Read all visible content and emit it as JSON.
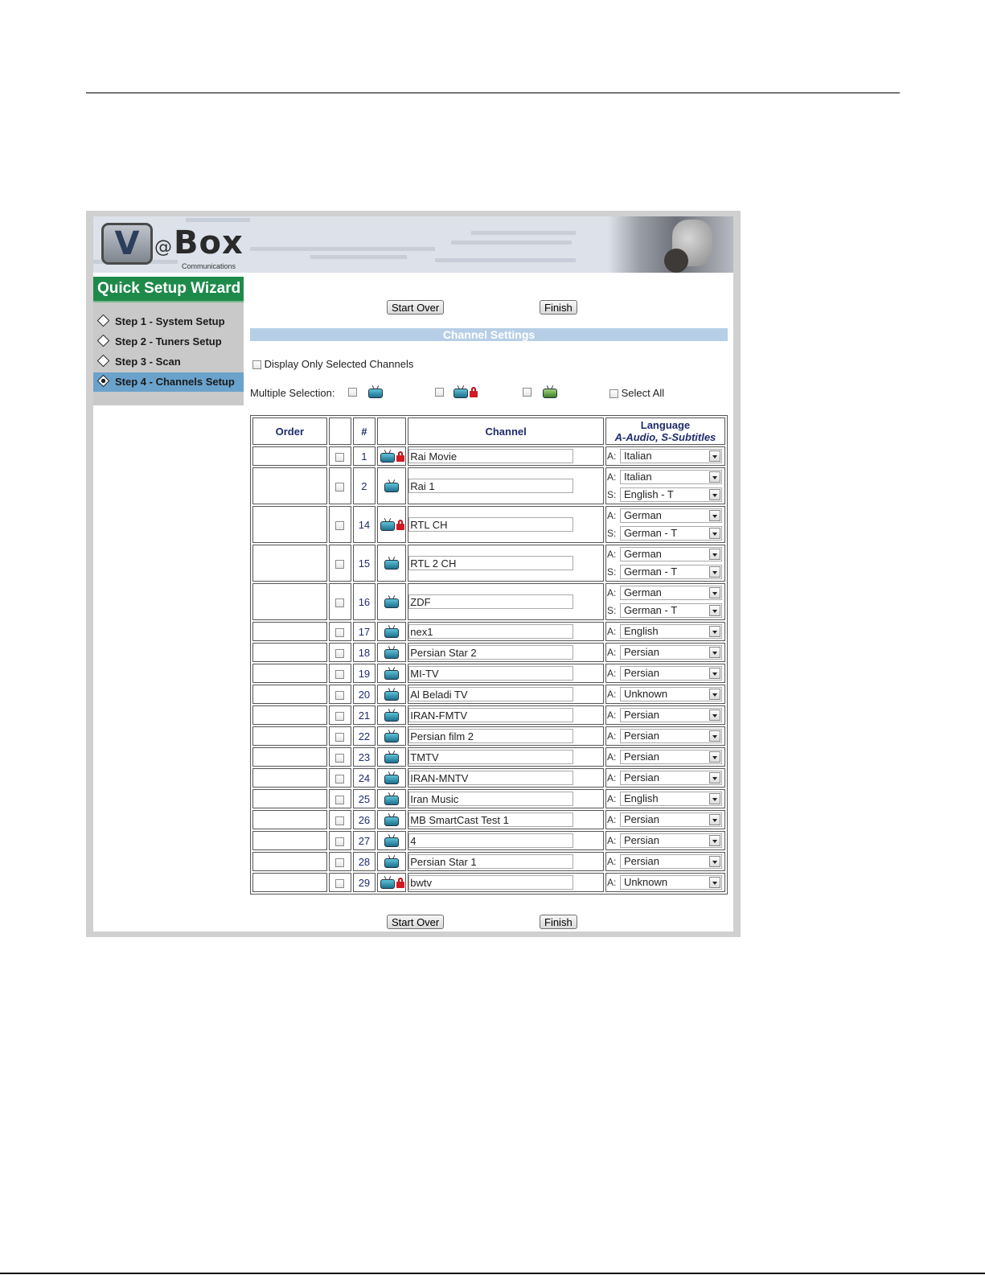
{
  "wizard": {
    "title": "Quick Setup Wizard",
    "steps": [
      {
        "label": "Step 1 - System Setup",
        "active": false
      },
      {
        "label": "Step 2 - Tuners Setup",
        "active": false
      },
      {
        "label": "Step 3 - Scan",
        "active": false
      },
      {
        "label": "Step 4 - Channels Setup",
        "active": true
      }
    ]
  },
  "logo": {
    "at": "@",
    "box": "Box",
    "sub": "Communications",
    "v": "V"
  },
  "buttons": {
    "start_over": "Start Over",
    "finish": "Finish"
  },
  "section_title": "Channel Settings",
  "filters": {
    "display_only_selected": "Display Only Selected Channels",
    "multiple_selection": "Multiple Selection:",
    "select_all": "Select All"
  },
  "table": {
    "headers": {
      "order": "Order",
      "num": "#",
      "channel": "Channel",
      "language": "Language",
      "language_sub": "A-Audio, S-Subtitles"
    },
    "rows": [
      {
        "num": "1",
        "lock": true,
        "name": "Rai Movie",
        "audio": "Italian",
        "subtitle": null
      },
      {
        "num": "2",
        "lock": false,
        "name": "Rai 1",
        "audio": "Italian",
        "subtitle": "English - T"
      },
      {
        "num": "14",
        "lock": true,
        "name": "RTL CH",
        "audio": "German",
        "subtitle": "German - T"
      },
      {
        "num": "15",
        "lock": false,
        "name": "RTL 2 CH",
        "audio": "German",
        "subtitle": "German - T"
      },
      {
        "num": "16",
        "lock": false,
        "name": "ZDF",
        "audio": "German",
        "subtitle": "German - T"
      },
      {
        "num": "17",
        "lock": false,
        "name": "nex1",
        "audio": "English",
        "subtitle": null
      },
      {
        "num": "18",
        "lock": false,
        "name": "Persian Star 2",
        "audio": "Persian",
        "subtitle": null
      },
      {
        "num": "19",
        "lock": false,
        "name": "MI-TV",
        "audio": "Persian",
        "subtitle": null
      },
      {
        "num": "20",
        "lock": false,
        "name": "Al Beladi TV",
        "audio": "Unknown",
        "subtitle": null
      },
      {
        "num": "21",
        "lock": false,
        "name": "IRAN-FMTV",
        "audio": "Persian",
        "subtitle": null
      },
      {
        "num": "22",
        "lock": false,
        "name": "Persian film 2",
        "audio": "Persian",
        "subtitle": null
      },
      {
        "num": "23",
        "lock": false,
        "name": "TMTV",
        "audio": "Persian",
        "subtitle": null
      },
      {
        "num": "24",
        "lock": false,
        "name": "IRAN-MNTV",
        "audio": "Persian",
        "subtitle": null
      },
      {
        "num": "25",
        "lock": false,
        "name": "Iran Music",
        "audio": "English",
        "subtitle": null
      },
      {
        "num": "26",
        "lock": false,
        "name": "MB SmartCast Test 1",
        "audio": "Persian",
        "subtitle": null
      },
      {
        "num": "27",
        "lock": false,
        "name": "4",
        "audio": "Persian",
        "subtitle": null
      },
      {
        "num": "28",
        "lock": false,
        "name": "Persian Star 1",
        "audio": "Persian",
        "subtitle": null
      },
      {
        "num": "29",
        "lock": true,
        "name": "bwtv",
        "audio": "Unknown",
        "subtitle": null
      }
    ],
    "audio_prefix": "A:",
    "subtitle_prefix": "S:"
  },
  "colors": {
    "wizard_green": "#1e8a4a",
    "active_step": "#6aa2cc",
    "section_bar": "#b7cfe6",
    "header_text": "#1f2c6e"
  },
  "icons": {
    "tv": "tv-icon",
    "lock": "lock-icon",
    "radio": "radio-icon"
  }
}
